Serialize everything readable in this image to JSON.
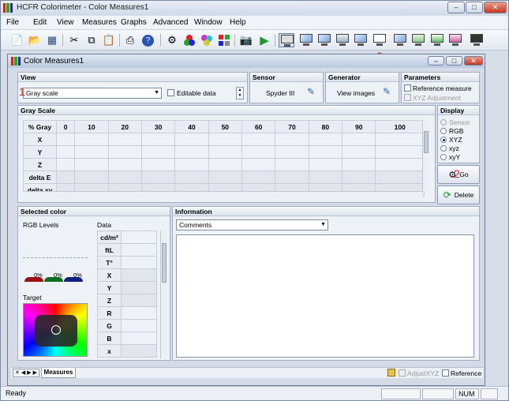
{
  "window": {
    "title": "HCFR Colorimeter - Color Measures1"
  },
  "menu": [
    "File",
    "Edit",
    "View",
    "Measures",
    "Graphs",
    "Advanced",
    "Window",
    "Help"
  ],
  "toolbar": {
    "icons": [
      "new-file-icon",
      "open-folder-icon",
      "save-icon",
      "cut-icon",
      "copy-icon",
      "paste-icon",
      "print-icon",
      "help-icon",
      "sensor-icon",
      "rgb-icon",
      "color-balls-icon",
      "color-blocks-icon",
      "camera-icon",
      "play-icon",
      "monitor-icon"
    ]
  },
  "child": {
    "title": "Color Measures1"
  },
  "view": {
    "header": "View",
    "select_value": "Gray scale",
    "editable_label": "Editable data"
  },
  "sensor": {
    "header": "Sensor",
    "button": "Spyder III"
  },
  "generator": {
    "header": "Generator",
    "button": "View images"
  },
  "parameters": {
    "header": "Parameters",
    "reference_measure": "Reference measure",
    "xyz_adjustment": "XYZ Adjustment"
  },
  "grayscale": {
    "header": "Gray Scale",
    "columns": [
      "% Gray",
      "0",
      "10",
      "20",
      "30",
      "40",
      "50",
      "60",
      "70",
      "80",
      "90",
      "100"
    ],
    "rows": [
      "X",
      "Y",
      "Z",
      "delta E",
      "delta xy"
    ]
  },
  "display": {
    "header": "Display",
    "options": [
      "Sensor",
      "RGB",
      "XYZ",
      "xyz",
      "xyY"
    ],
    "selected": "XYZ"
  },
  "actions": {
    "go": "Go",
    "delete": "Delete"
  },
  "selected_color": {
    "header": "Selected color",
    "rgb_levels": "RGB Levels",
    "data_label": "Data",
    "pcts": [
      "0%",
      "0%",
      "0%"
    ],
    "target": "Target",
    "data_rows": [
      "cd/m²",
      "ftL",
      "T°",
      "X",
      "Y",
      "Z",
      "R",
      "G",
      "B",
      "x"
    ]
  },
  "information": {
    "header": "Information",
    "select_value": "Comments"
  },
  "bottom": {
    "tab": "Measures",
    "adjust": "AdjustXYZ",
    "reference": "Reference"
  },
  "status": {
    "text": "Ready",
    "num": "NUM"
  },
  "annotations": [
    "1",
    "2",
    "3"
  ]
}
